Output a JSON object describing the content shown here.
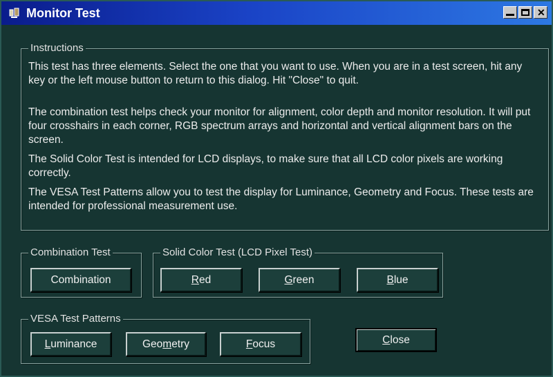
{
  "window": {
    "title": "Monitor Test",
    "icon": "monitor-test-app-icon",
    "controls": {
      "minimize": "minimize-icon",
      "maximize": "maximize-icon",
      "close": "close-icon"
    }
  },
  "instructions": {
    "legend": "Instructions",
    "paragraphs": [
      "This test has three elements. Select the one that you want to use. When you are in a test screen, hit any key or the left mouse button to return to this dialog. Hit \"Close\" to quit.",
      "The combination test helps check your monitor for alignment, color depth and monitor resolution. It will put four crosshairs in each corner, RGB spectrum arrays and horizontal and vertical alignment bars on the screen.",
      "The Solid Color Test is intended for LCD displays, to make sure that all LCD color pixels are working correctly.",
      "The VESA Test Patterns allow you to test the display for Luminance, Geometry and Focus. These tests are intended for professional measurement use."
    ]
  },
  "combination_group": {
    "legend": "Combination Test",
    "button": "Combination"
  },
  "solid_group": {
    "legend": "Solid Color Test (LCD Pixel Test)",
    "red": {
      "pre": "",
      "key": "R",
      "post": "ed"
    },
    "green": {
      "pre": "",
      "key": "G",
      "post": "reen"
    },
    "blue": {
      "pre": "",
      "key": "B",
      "post": "lue"
    }
  },
  "vesa_group": {
    "legend": "VESA Test Patterns",
    "luminance": {
      "pre": "",
      "key": "L",
      "post": "uminance"
    },
    "geometry": {
      "pre": "Geo",
      "key": "m",
      "post": "etry"
    },
    "focus": {
      "pre": "",
      "key": "F",
      "post": "ocus"
    }
  },
  "close_button": {
    "pre": "",
    "key": "C",
    "post": "lose"
  },
  "colors": {
    "dialog_bg": "#163532",
    "title_gradient_start": "#0a1c8c",
    "title_gradient_end": "#2d78e3",
    "text": "#e6e6e6"
  }
}
